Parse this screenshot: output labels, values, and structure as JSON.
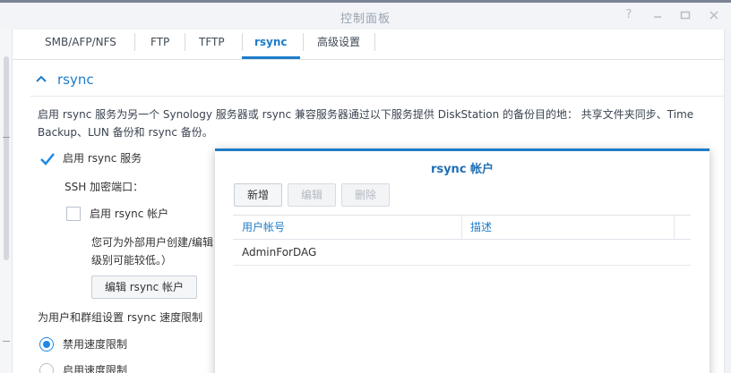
{
  "window": {
    "title": "控制面板",
    "controls": [
      "help-icon",
      "minimize-icon",
      "maximize-icon",
      "close-icon"
    ]
  },
  "tabs": [
    {
      "label": "SMB/AFP/NFS",
      "active": false
    },
    {
      "label": "FTP",
      "active": false
    },
    {
      "label": "TFTP",
      "active": false
    },
    {
      "label": "rsync",
      "active": true
    },
    {
      "label": "高级设置",
      "active": false
    }
  ],
  "section": {
    "title": "rsync",
    "description_line1": "启用 rsync 服务为另一个 Synology 服务器或 rsync 兼容服务器通过以下服务提供 DiskStation 的备份目的地： 共享文件夹同步、Time",
    "description_line2": "Backup、LUN 备份和 rsync 备份。",
    "enable_rsync_label": "启用 rsync 服务",
    "enable_rsync_checked": true,
    "ssh_port_label": "SSH 加密端口：",
    "enable_account_label": "启用 rsync 帐户",
    "enable_account_checked": false,
    "account_note_line1": "您可为外部用户创建/编辑",
    "account_note_line2": "级别可能较低。）",
    "edit_account_button": "编辑 rsync 帐户",
    "speed_limit_label": "为用户和群组设置 rsync 速度限制",
    "speed_options": [
      {
        "label": "禁用速度限制",
        "selected": true
      },
      {
        "label": "启用速度限制",
        "selected": false
      }
    ]
  },
  "dialog": {
    "title": "rsync 帐户",
    "buttons": {
      "add": "新增",
      "edit": "编辑",
      "delete": "删除"
    },
    "columns": [
      "用户帐号",
      "描述"
    ],
    "rows": [
      {
        "user": "AdminForDAG",
        "description": ""
      }
    ]
  },
  "colors": {
    "accent": "#1e7cc8",
    "radio_selected": "#1e88e5"
  }
}
